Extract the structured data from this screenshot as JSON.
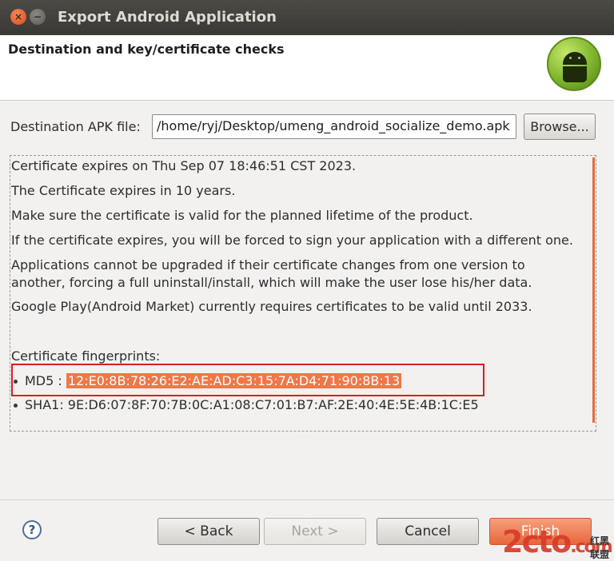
{
  "window": {
    "title": "Export Android Application"
  },
  "banner": {
    "heading": "Destination and key/certificate checks"
  },
  "destination": {
    "label": "Destination APK file:",
    "value": "/home/ryj/Desktop/umeng_android_socialize_demo.apk",
    "browse_label": "Browse..."
  },
  "info": {
    "lines": [
      "Certificate expires on Thu Sep 07 18:46:51 CST 2023.",
      "The Certificate expires in 10 years.",
      "Make sure the certificate is valid for the planned lifetime of the product.",
      "If the certificate expires, you will be forced to sign your application with a different one.",
      "Applications cannot be upgraded if their certificate changes from one version to",
      "another, forcing a full uninstall/install, which will make the user lose his/her data.",
      "Google Play(Android Market) currently requires certificates to be valid until 2033."
    ],
    "fingerprints_title": "Certificate fingerprints:",
    "md5_label": "MD5 : ",
    "md5_value": "12:E0:8B:78:26:E2:AE:AD:C3:15:7A:D4:71:90:8B:13",
    "sha1_label": "SHA1: ",
    "sha1_value": "9E:D6:07:8F:70:7B:0C:A1:08:C7:01:B7:AF:2E:40:4E:5E:4B:1C:E5"
  },
  "buttons": {
    "help": "?",
    "back": "< Back",
    "next": "Next >",
    "cancel": "Cancel",
    "finish": "Finish"
  },
  "watermark": {
    "brand": "2cto",
    "suffix": ".com",
    "cn": "红黑联盟"
  },
  "colors": {
    "accent": "#e8663a",
    "highlight_border": "#d9201e",
    "titlebar": "#3a3935"
  }
}
